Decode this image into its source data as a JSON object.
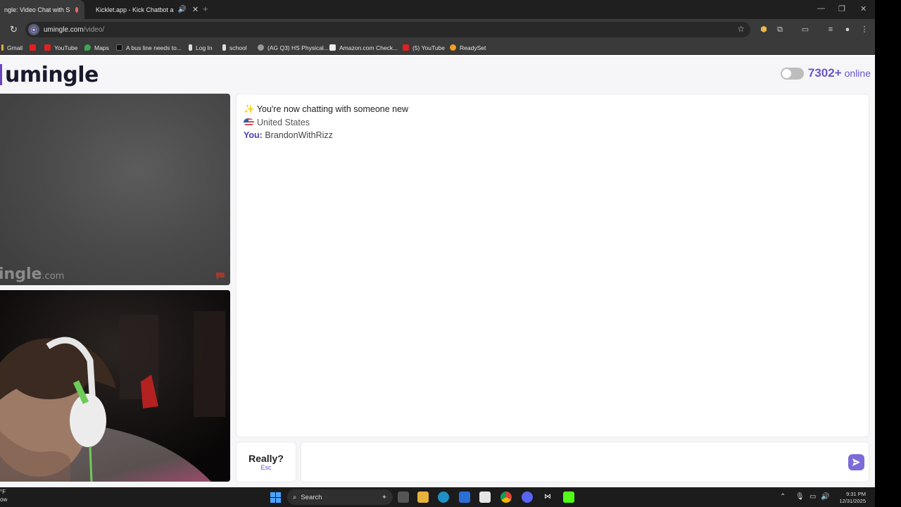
{
  "browser": {
    "tabs": [
      {
        "title": "ngle: Video Chat with S",
        "active": true
      },
      {
        "title": "Kicklet.app - Kick Chatbot a",
        "active": false
      }
    ],
    "url_host": "umingle.com",
    "url_path": "/video/",
    "bookmarks": [
      "Gmail",
      "YouTube",
      "Maps",
      "A bus line needs to...",
      "Log In",
      "school",
      "(AG Q3) HS Physical...",
      "Amazon.com Check...",
      "(5) YouTube",
      "ReadySet"
    ]
  },
  "header": {
    "logo": "umingle",
    "online_count": "7302+",
    "online_label": "online"
  },
  "video": {
    "watermark": "ingle",
    "watermark_suffix": ".com"
  },
  "chat": {
    "intro_icon": "✨",
    "intro": "You're now chatting with someone new",
    "country": "United States",
    "you_label": "You:",
    "you_name": "BrandonWithRizz"
  },
  "controls": {
    "esc_label": "Really?",
    "esc_hint": "Esc",
    "input_value": "",
    "input_placeholder": ""
  },
  "taskbar": {
    "weather": "°F",
    "weather_sub": "ow",
    "search": "Search",
    "time": "9:31 PM",
    "date": "12/31/2025"
  },
  "colors": {
    "brand": "#6b55c8",
    "send": "#7c6ad9"
  }
}
